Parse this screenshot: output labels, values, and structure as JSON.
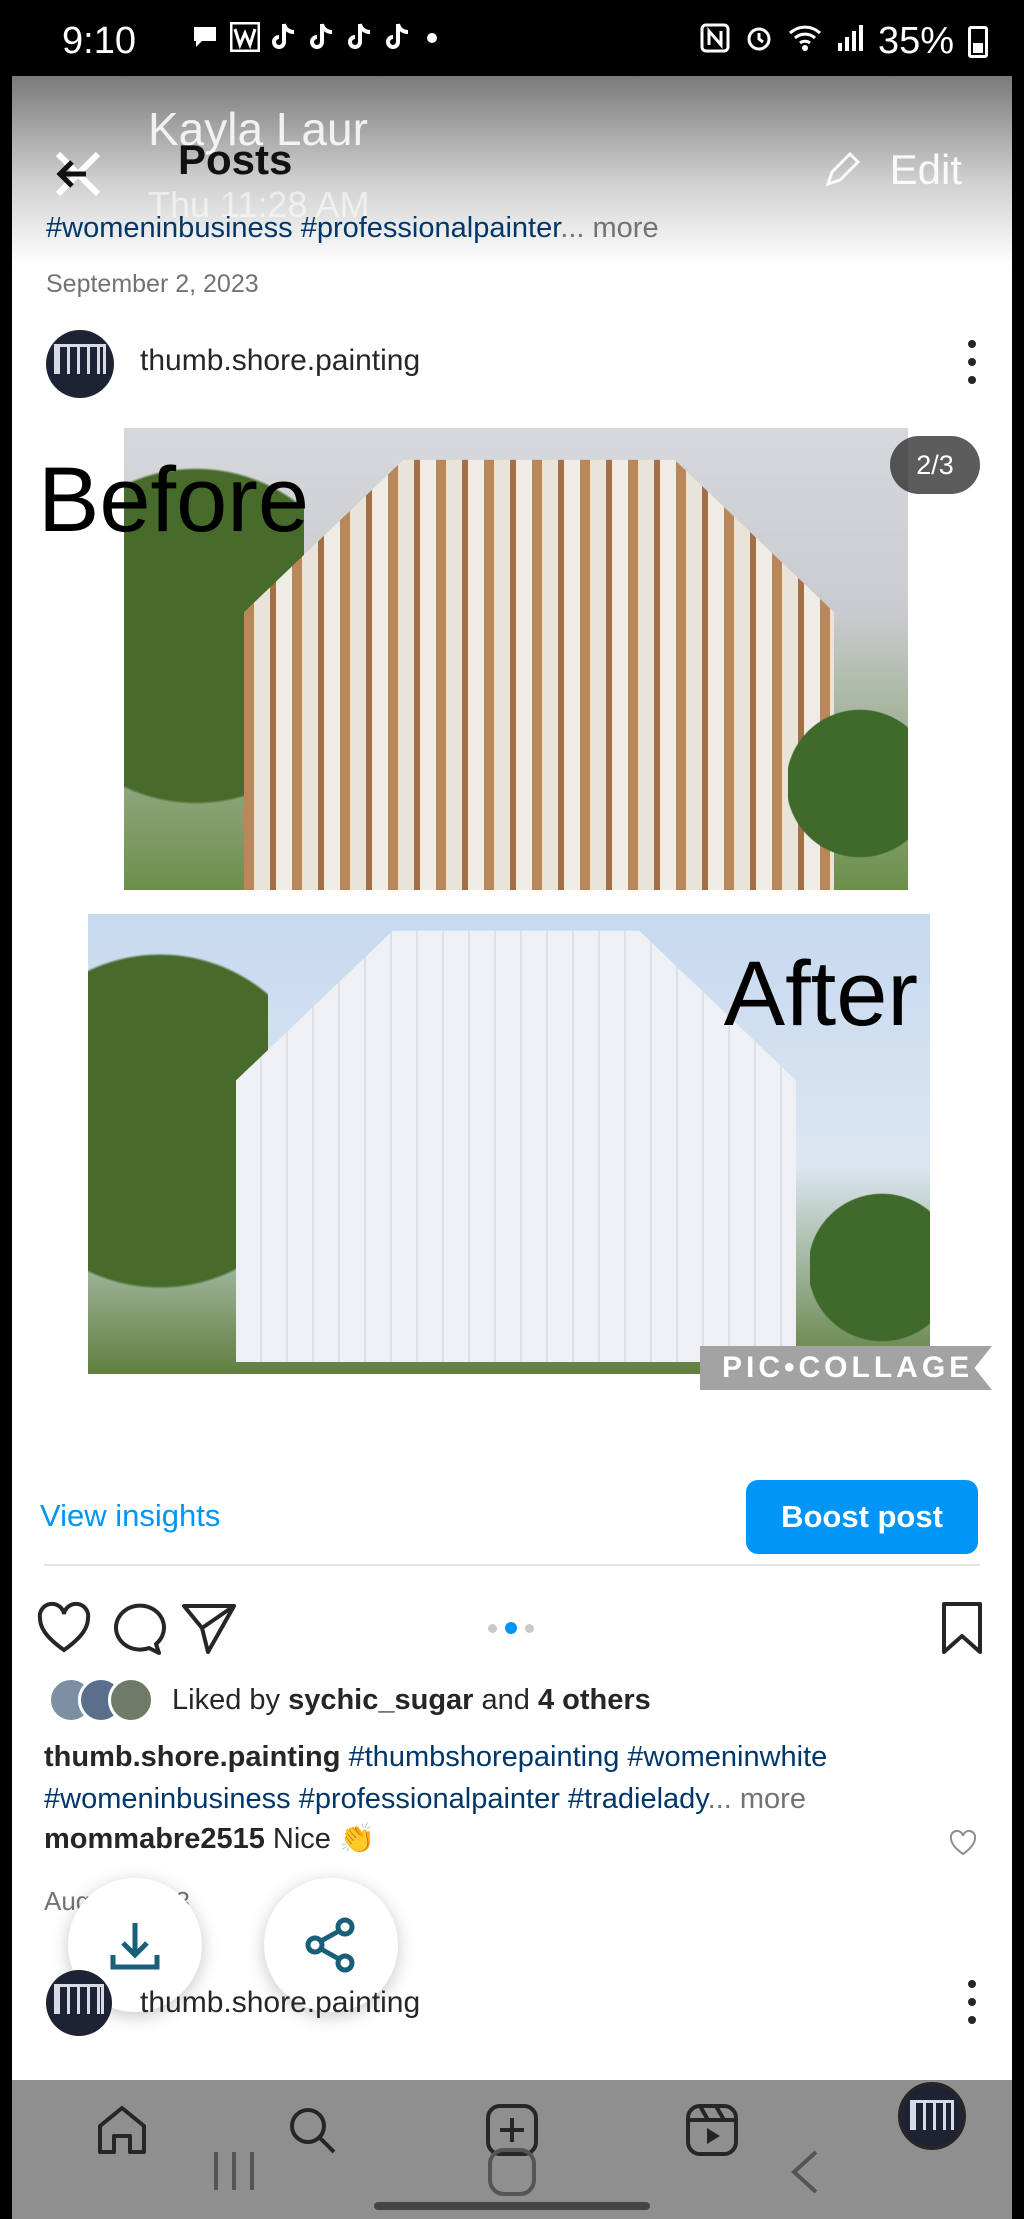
{
  "status_bar": {
    "time": "9:10",
    "left_icons": [
      "chat-bubble-icon",
      "w-icon",
      "tiktok-icon",
      "tiktok-icon",
      "tiktok-icon",
      "tiktok-icon",
      "dot-icon"
    ],
    "right_icons": [
      "nfc-icon",
      "alarm-icon",
      "wifi-icon",
      "signal-icon",
      "battery-icon"
    ],
    "battery": "35%"
  },
  "overlay": {
    "ghost_name": "Kayla Laur",
    "ghost_time": "Thu 11:28 AM",
    "edit_label": "Edit"
  },
  "header": {
    "title": "Posts",
    "back_icon": "arrow-left-icon"
  },
  "previous_post": {
    "tags": "#womeninbusiness #professionalpainter",
    "more": "... more",
    "date": "September 2, 2023"
  },
  "post": {
    "username": "thumb.shore.painting",
    "counter": "2/3",
    "label_before": "Before",
    "label_after": "After",
    "watermark": "PIC•COLLAGE",
    "view_insights": "View insights",
    "boost_post": "Boost post",
    "carousel_dots": 3,
    "carousel_active": 2,
    "likes": {
      "prefix": "Liked by",
      "user": "sychic_sugar",
      "middle": "and",
      "others": "4 others"
    },
    "caption": {
      "username": "thumb.shore.painting",
      "tags": "#thumbshorepainting #womeninwhite #womeninbusiness #professionalpainter #tradielady",
      "more": "... more"
    },
    "comment": {
      "username": "mommabre2515",
      "text": "Nice 👏"
    },
    "date": "August 2023"
  },
  "floating_buttons": [
    "download-icon",
    "share-icon"
  ],
  "next_post": {
    "username": "thumb.shore.painting"
  },
  "bottom_nav": [
    "home-icon",
    "search-icon",
    "create-icon",
    "reels-icon",
    "profile-avatar"
  ],
  "system_nav": [
    "recents-icon",
    "home-button-icon",
    "back-icon"
  ],
  "colors": {
    "accent": "#0095f6",
    "hashtag": "#00376b",
    "secondary_text": "#737373"
  }
}
